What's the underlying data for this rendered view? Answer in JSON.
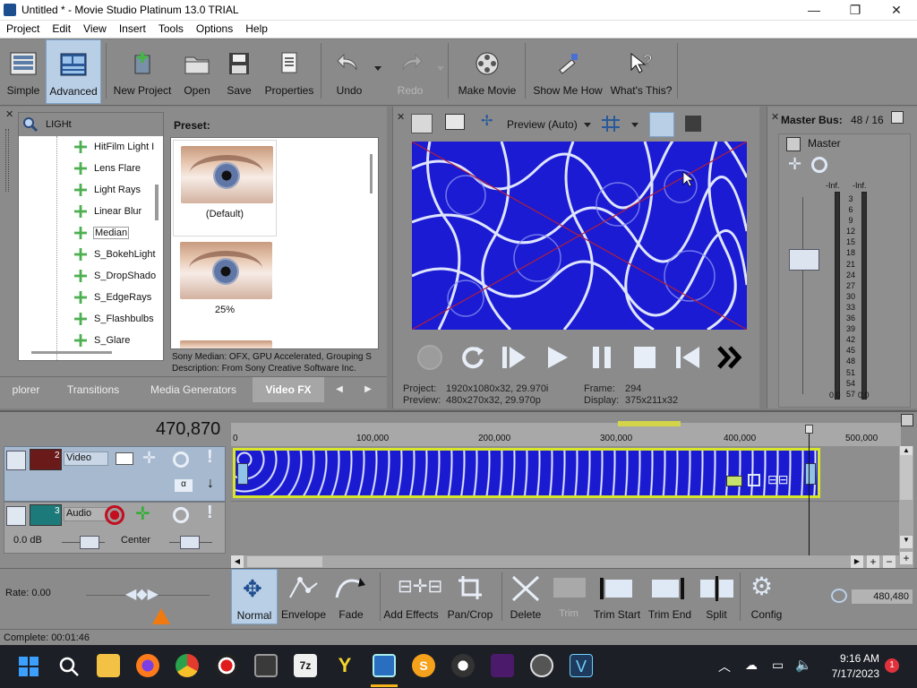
{
  "window": {
    "title": "Untitled * - Movie Studio Platinum 13.0 TRIAL",
    "minimize": "—",
    "maximize": "❐",
    "close": "✕"
  },
  "menu": [
    "Project",
    "Edit",
    "View",
    "Insert",
    "Tools",
    "Options",
    "Help"
  ],
  "toolbar": {
    "simple": "Simple",
    "advanced": "Advanced",
    "new_project": "New Project",
    "open": "Open",
    "save": "Save",
    "properties": "Properties",
    "undo": "Undo",
    "redo": "Redo",
    "make_movie": "Make Movie",
    "show_me_how": "Show Me How",
    "whats_this": "What's This?"
  },
  "fx": {
    "search_value": "LIGHt",
    "tree_items": [
      "HitFilm Light I",
      "Lens Flare",
      "Light Rays",
      "Linear Blur",
      "Median",
      "S_BokehLight",
      "S_DropShado",
      "S_EdgeRays",
      "S_Flashbulbs",
      "S_Glare"
    ],
    "preset_label": "Preset:",
    "presets": [
      "(Default)",
      "25%"
    ],
    "description_line1": "Sony Median: OFX, GPU Accelerated, Grouping S",
    "description_line2": "Description: From Sony Creative Software Inc.",
    "tabs": [
      "plorer",
      "Transitions",
      "Media Generators",
      "Video FX"
    ],
    "tab_prev": "◀",
    "tab_next": "▶"
  },
  "preview": {
    "mode_label": "Preview (Auto)",
    "project_label": "Project:",
    "project_value": "1920x1080x32, 29.970i",
    "preview_label": "Preview:",
    "preview_value": "480x270x32, 29.970p",
    "frame_label": "Frame:",
    "frame_value": "294",
    "display_label": "Display:",
    "display_value": "375x211x32"
  },
  "master": {
    "title": "Master Bus:",
    "bus_value": "48 / 16",
    "label": "Master",
    "inf_left": "-Inf.",
    "inf_right": "-Inf.",
    "scale": [
      "3",
      "6",
      "9",
      "12",
      "15",
      "18",
      "21",
      "24",
      "27",
      "30",
      "33",
      "36",
      "39",
      "42",
      "45",
      "48",
      "51",
      "54",
      "57"
    ],
    "bottom_left": "0.0",
    "bottom_right": "0.0"
  },
  "timeline": {
    "position": "470,870",
    "ruler": [
      "0",
      "100,000",
      "200,000",
      "300,000",
      "400,000",
      "500,000"
    ],
    "video_track": {
      "number": "2",
      "name": "Video"
    },
    "audio_track": {
      "number": "3",
      "name": "Audio",
      "volume": "0.0 dB",
      "pan": "Center"
    }
  },
  "edit_tools": {
    "normal": "Normal",
    "envelope": "Envelope",
    "fade": "Fade",
    "add_effects": "Add Effects",
    "pan_crop": "Pan/Crop",
    "delete": "Delete",
    "trim": "Trim",
    "trim_start": "Trim Start",
    "trim_end": "Trim End",
    "split": "Split",
    "config": "Config",
    "rate": "Rate: 0.00",
    "zoom_value": "480,480"
  },
  "status": {
    "text": "Complete: 00:01:46"
  },
  "taskbar": {
    "time": "9:16 AM",
    "date": "7/17/2023",
    "notification_count": "1"
  },
  "colors": {
    "toolbar_bg": "#8a8a8a",
    "video_clip": "#1d1dd6",
    "clip_border": "#d7e62a",
    "selected_tool": "#b9cfe6"
  }
}
